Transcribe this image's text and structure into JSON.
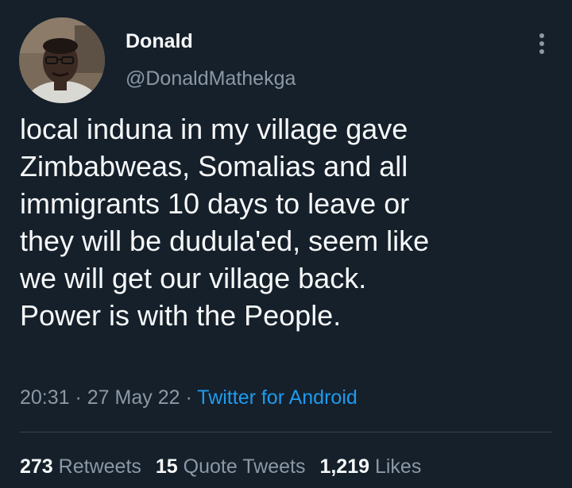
{
  "author": {
    "name": "Donald",
    "handle": "@DonaldMathekga"
  },
  "tweet": {
    "lines": [
      "local induna in my village gave",
      "Zimbabweas, Somalias and all",
      "immigrants 10 days to leave or",
      "they will be dudula'ed, seem like",
      "we will get our village back.",
      "Power is with the People."
    ],
    "time": "20:31",
    "date": "27 May 22",
    "separator": " · ",
    "source": "Twitter for Android"
  },
  "stats": {
    "retweets": {
      "count": "273",
      "label": "Retweets"
    },
    "quotes": {
      "count": "15",
      "label": "Quote Tweets"
    },
    "likes": {
      "count": "1,219",
      "label": "Likes"
    }
  },
  "icons": {
    "more": "more-vertical-icon"
  },
  "colors": {
    "background": "#15202b",
    "primary_text": "#f7f9f9",
    "secondary_text": "#8b98a5",
    "link": "#1d9bf0",
    "divider": "#38444d"
  }
}
